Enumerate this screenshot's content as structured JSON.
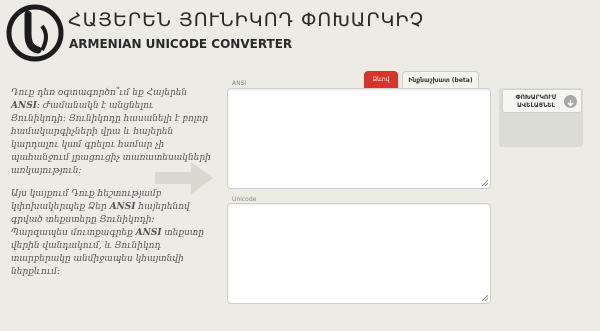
{
  "header": {
    "title_armenian": "ՀԱՅԵՐԵՆ ՅՈՒՆԻԿՈԴ ՓՈԽԱՐԿԻՉ",
    "title_english": "ARMENIAN UNICODE CONVERTER"
  },
  "intro": {
    "paragraph1_prefix": "Դուք դեռ օգտագործո՞ւմ եք Հայերեն ",
    "paragraph1_bold": "ANSI",
    "paragraph1_suffix": ": Ժամանակն է անցնելու Յունիկոդի: Յունիկոդը հասանելի է բոլոր համակարգիչների վրա և հայերեն կարդալու կամ գրելու համար չի պահանջում լրացուցիչ տառատեսակների առկայություն:",
    "paragraph2_prefix": "Այս կայքում Դուք հեշտությամբ կփոխակերպեք Ձեր ",
    "paragraph2_bold": "ANSI",
    "paragraph2_suffix": " հայերենով գրված տեքստերը Յունիկոդի: Պարզապես մուտքագրեք ",
    "paragraph2_bold2": "ANSI",
    "paragraph2_suffix2": " տեքստը վերին վանդակում, և Յունիկոդ տարբերակը անմիջապես կհայտնվի ներքևում:"
  },
  "converter": {
    "ansi_label": "ANSI",
    "unicode_label": "Unicode",
    "tab_active": "Ձևով",
    "tab_beta": "Ինքնաշխատ (beta)",
    "convert_button": "ՓՈԽԱՐԿՈՒՄ ԱՎԵԼԱՑՆԵԼ",
    "ansi_value": "",
    "unicode_value": ""
  },
  "colors": {
    "background": "#ecebe5",
    "accent": "#d9342b"
  }
}
